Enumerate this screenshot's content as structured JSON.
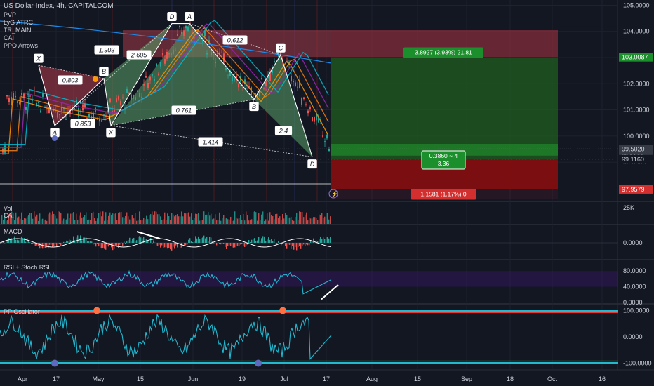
{
  "header": {
    "symbol": "US Dollar Index, 4h, CAPITALCOM",
    "indicators": [
      "PVP",
      "LyG ATRC",
      "TR_MAIN",
      "CAI",
      "PPO Arrows"
    ]
  },
  "colors": {
    "background": "#131722",
    "up": "#26a69a",
    "down": "#ef5350",
    "profit_zone": "#1b5e20",
    "loss_zone": "#8b0d0d",
    "pattern_red": "#b23b4a",
    "pattern_green": "#5aa06a",
    "cyan": "#22b8cf",
    "price_tag": "#e0e3eb"
  },
  "price_axis": {
    "ticks": [
      "105.0000",
      "104.0000",
      "103.0000",
      "102.0000",
      "101.0000",
      "100.0000",
      "99.0000"
    ],
    "tags": [
      {
        "label": "103.0087",
        "kind": "green"
      },
      {
        "label": "99.5020",
        "sub": "03:14:51",
        "kind": "gray"
      },
      {
        "label": "99.1160",
        "kind": "plain"
      },
      {
        "label": "97.9579",
        "kind": "red"
      }
    ]
  },
  "date_axis": [
    "Apr",
    "17",
    "May",
    "15",
    "Jun",
    "19",
    "Jul",
    "17",
    "Aug",
    "15",
    "Sep",
    "18",
    "Oct",
    "16"
  ],
  "trade": {
    "target_label": "3.8927 (3.93%) 21.81",
    "ratio_label_1": "0.3860 ~ 4",
    "ratio_label_2": "3.36",
    "stop_label": "1.1581 (1.17%) 0"
  },
  "pattern_points": [
    "X",
    "A",
    "B",
    "X",
    "D",
    "A",
    "B",
    "C",
    "D"
  ],
  "pattern_ratios": [
    "0.803",
    "1.903",
    "2.605",
    "0.853",
    "0.761",
    "0.612",
    "1.414",
    "2.4"
  ],
  "panes": {
    "volume": {
      "title": "Vol",
      "sub": "CAI",
      "tick": "25K"
    },
    "macd": {
      "title": "MACD",
      "tick": "0.0000"
    },
    "rsi": {
      "title": "RSI + Stoch RSI",
      "ticks": [
        "80.0000",
        "40.0000",
        "0.0000"
      ]
    },
    "pp": {
      "title": "PP Oscillator",
      "ticks": [
        "100.0000",
        "0.0000",
        "-100.0000"
      ]
    }
  },
  "chart_data": {
    "type": "line",
    "title": "US Dollar Index, 4h, CAPITALCOM",
    "ylim": [
      97.5,
      105.2
    ],
    "x": [
      "Apr",
      "Apr 17",
      "May",
      "May 15",
      "Jun",
      "Jun 19",
      "Jul",
      "Jul 17"
    ],
    "series": [
      {
        "values": [
          101.6,
          101.1,
          100.8,
          101.7,
          104.3,
          101.5,
          103.1,
          99.5
        ]
      }
    ],
    "harmonic_pattern": [
      {
        "point": "X",
        "price": 102.7
      },
      {
        "point": "A",
        "price": 100.4
      },
      {
        "point": "B",
        "price": 102.2
      },
      {
        "point": "X",
        "price": 100.4
      },
      {
        "point": "D",
        "price": 104.3
      },
      {
        "point": "A",
        "price": 104.3
      },
      {
        "point": "B",
        "price": 101.4
      },
      {
        "point": "C",
        "price": 103.1
      },
      {
        "point": "D",
        "price": 99.2
      }
    ],
    "trade_setup": {
      "entry": 99.116,
      "target": 103.0087,
      "stop": 97.9579
    }
  }
}
